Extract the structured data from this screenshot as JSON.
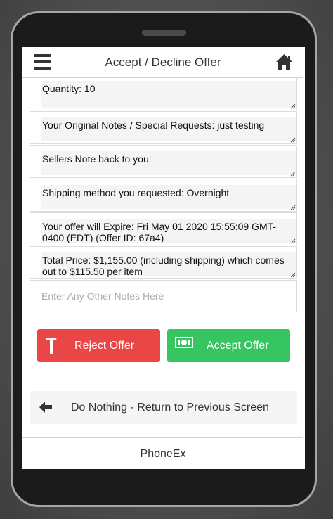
{
  "header": {
    "title": "Accept / Decline Offer",
    "menu_icon": "hamburger-menu-icon",
    "home_icon": "home-icon"
  },
  "offer_fields": [
    {
      "text": "Quantity: 10"
    },
    {
      "text": "Your Original Notes / Special Requests: just testing"
    },
    {
      "text": "Sellers Note back to you:"
    },
    {
      "text": "Shipping method you requested: Overnight"
    },
    {
      "text": "Your offer will Expire: Fri May 01 2020 15:55:09 GMT-0400 (EDT) (Offer ID: 67a4)"
    },
    {
      "text": "Total Price: $1,155.00 (including shipping) which comes out to $115.50 per item"
    }
  ],
  "notes_input": {
    "placeholder": "Enter Any Other Notes Here",
    "value": ""
  },
  "actions": {
    "reject_label": "Reject Offer",
    "reject_icon": "hammer-icon",
    "reject_color": "#ea4645",
    "accept_label": "Accept Offer",
    "accept_icon": "money-icon",
    "accept_color": "#37c562"
  },
  "back": {
    "label": "Do Nothing - Return to Previous Screen",
    "icon": "arrow-left-icon"
  },
  "footer": {
    "label": "PhoneEx"
  }
}
